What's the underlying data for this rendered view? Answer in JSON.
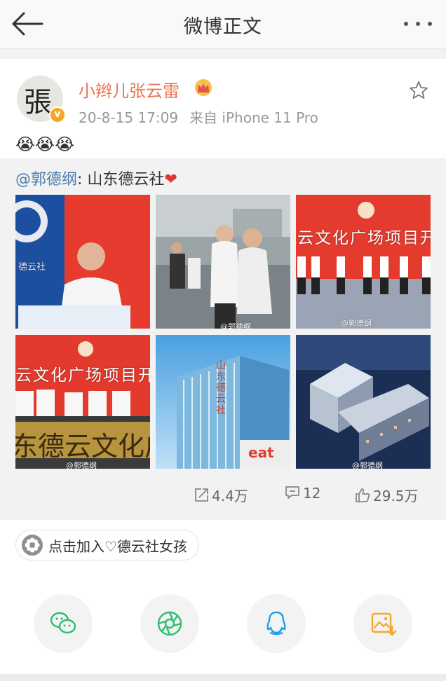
{
  "nav": {
    "title": "微博正文"
  },
  "post": {
    "username": "小辫儿张云雷",
    "avatar_glyph": "張",
    "verified_badge": "v",
    "time": "20-8-15 17:09",
    "source": "来自 iPhone 11 Pro",
    "text": "😭😭😭"
  },
  "repost": {
    "mention": "@郭德纲",
    "separator": ":",
    "text": " 山东德云社",
    "heart": "❤",
    "images": [
      {
        "name": "speech-photo",
        "banner": "德云社"
      },
      {
        "name": "walking-photo",
        "watermark": "@郭德纲"
      },
      {
        "name": "stage-photo",
        "banner": "云文化广场项目开",
        "watermark": "@郭德纲"
      },
      {
        "name": "ceremony-photo",
        "banner": "云文化广场项目开",
        "sign": "东德云文化广",
        "watermark": "@郭德纲"
      },
      {
        "name": "building-photo",
        "sign": "山东德云社",
        "logo": "eat"
      },
      {
        "name": "aerial-night-photo",
        "watermark": "@郭德纲"
      }
    ],
    "stats": {
      "reposts": "4.4万",
      "comments": "12",
      "likes": "29.5万"
    }
  },
  "chip": {
    "label": "点击加入♡德云社女孩"
  },
  "share": [
    {
      "name": "wechat",
      "color": "#2bbf70"
    },
    {
      "name": "moments",
      "color": "#2bbf70"
    },
    {
      "name": "qq",
      "color": "#1e9ff2"
    },
    {
      "name": "save-image",
      "color": "#f5a623"
    }
  ],
  "colors": {
    "username": "#eb7350",
    "mention": "#507daf",
    "background_gray": "#f2f2f2"
  }
}
